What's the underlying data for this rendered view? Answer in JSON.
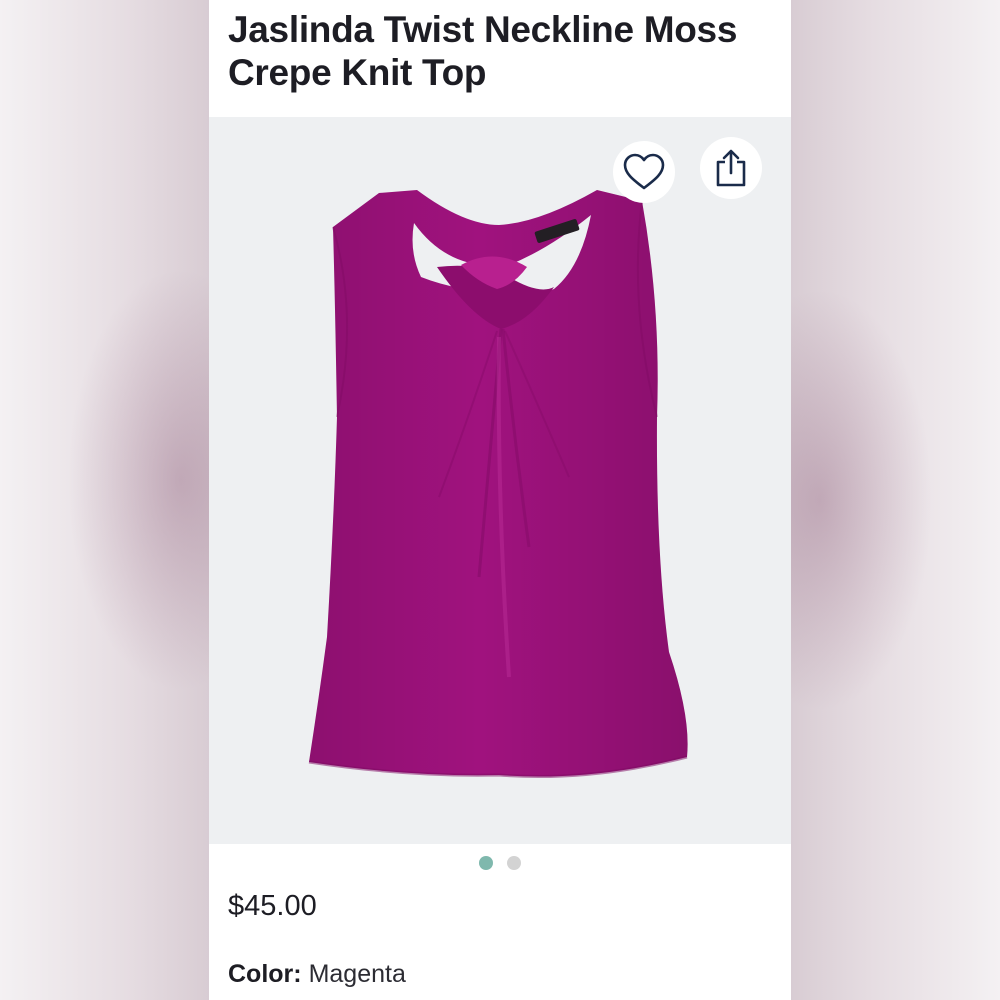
{
  "product": {
    "title": "Jaslinda Twist Neckline Moss Crepe Knit Top",
    "price": "$45.00",
    "color_label": "Color:",
    "color_value": "Magenta",
    "garment_color": "#a0127e"
  },
  "actions": {
    "favorite_icon": "heart-icon",
    "share_icon": "share-icon"
  },
  "carousel": {
    "count": 2,
    "active_index": 0,
    "active_color": "#7fb8ad",
    "inactive_color": "#d3d3d3"
  }
}
